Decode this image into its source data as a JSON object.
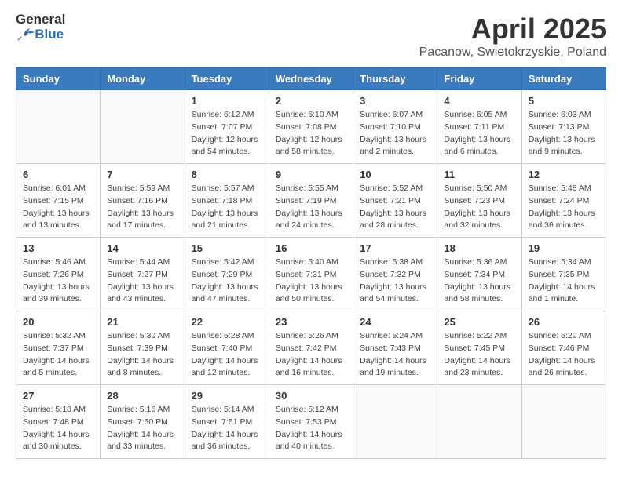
{
  "logo": {
    "general": "General",
    "blue": "Blue"
  },
  "title": {
    "month_year": "April 2025",
    "location": "Pacanow, Swietokrzyskie, Poland"
  },
  "headers": [
    "Sunday",
    "Monday",
    "Tuesday",
    "Wednesday",
    "Thursday",
    "Friday",
    "Saturday"
  ],
  "weeks": [
    [
      {
        "day": "",
        "info": ""
      },
      {
        "day": "",
        "info": ""
      },
      {
        "day": "1",
        "info": "Sunrise: 6:12 AM\nSunset: 7:07 PM\nDaylight: 12 hours\nand 54 minutes."
      },
      {
        "day": "2",
        "info": "Sunrise: 6:10 AM\nSunset: 7:08 PM\nDaylight: 12 hours\nand 58 minutes."
      },
      {
        "day": "3",
        "info": "Sunrise: 6:07 AM\nSunset: 7:10 PM\nDaylight: 13 hours\nand 2 minutes."
      },
      {
        "day": "4",
        "info": "Sunrise: 6:05 AM\nSunset: 7:11 PM\nDaylight: 13 hours\nand 6 minutes."
      },
      {
        "day": "5",
        "info": "Sunrise: 6:03 AM\nSunset: 7:13 PM\nDaylight: 13 hours\nand 9 minutes."
      }
    ],
    [
      {
        "day": "6",
        "info": "Sunrise: 6:01 AM\nSunset: 7:15 PM\nDaylight: 13 hours\nand 13 minutes."
      },
      {
        "day": "7",
        "info": "Sunrise: 5:59 AM\nSunset: 7:16 PM\nDaylight: 13 hours\nand 17 minutes."
      },
      {
        "day": "8",
        "info": "Sunrise: 5:57 AM\nSunset: 7:18 PM\nDaylight: 13 hours\nand 21 minutes."
      },
      {
        "day": "9",
        "info": "Sunrise: 5:55 AM\nSunset: 7:19 PM\nDaylight: 13 hours\nand 24 minutes."
      },
      {
        "day": "10",
        "info": "Sunrise: 5:52 AM\nSunset: 7:21 PM\nDaylight: 13 hours\nand 28 minutes."
      },
      {
        "day": "11",
        "info": "Sunrise: 5:50 AM\nSunset: 7:23 PM\nDaylight: 13 hours\nand 32 minutes."
      },
      {
        "day": "12",
        "info": "Sunrise: 5:48 AM\nSunset: 7:24 PM\nDaylight: 13 hours\nand 36 minutes."
      }
    ],
    [
      {
        "day": "13",
        "info": "Sunrise: 5:46 AM\nSunset: 7:26 PM\nDaylight: 13 hours\nand 39 minutes."
      },
      {
        "day": "14",
        "info": "Sunrise: 5:44 AM\nSunset: 7:27 PM\nDaylight: 13 hours\nand 43 minutes."
      },
      {
        "day": "15",
        "info": "Sunrise: 5:42 AM\nSunset: 7:29 PM\nDaylight: 13 hours\nand 47 minutes."
      },
      {
        "day": "16",
        "info": "Sunrise: 5:40 AM\nSunset: 7:31 PM\nDaylight: 13 hours\nand 50 minutes."
      },
      {
        "day": "17",
        "info": "Sunrise: 5:38 AM\nSunset: 7:32 PM\nDaylight: 13 hours\nand 54 minutes."
      },
      {
        "day": "18",
        "info": "Sunrise: 5:36 AM\nSunset: 7:34 PM\nDaylight: 13 hours\nand 58 minutes."
      },
      {
        "day": "19",
        "info": "Sunrise: 5:34 AM\nSunset: 7:35 PM\nDaylight: 14 hours\nand 1 minute."
      }
    ],
    [
      {
        "day": "20",
        "info": "Sunrise: 5:32 AM\nSunset: 7:37 PM\nDaylight: 14 hours\nand 5 minutes."
      },
      {
        "day": "21",
        "info": "Sunrise: 5:30 AM\nSunset: 7:39 PM\nDaylight: 14 hours\nand 8 minutes."
      },
      {
        "day": "22",
        "info": "Sunrise: 5:28 AM\nSunset: 7:40 PM\nDaylight: 14 hours\nand 12 minutes."
      },
      {
        "day": "23",
        "info": "Sunrise: 5:26 AM\nSunset: 7:42 PM\nDaylight: 14 hours\nand 16 minutes."
      },
      {
        "day": "24",
        "info": "Sunrise: 5:24 AM\nSunset: 7:43 PM\nDaylight: 14 hours\nand 19 minutes."
      },
      {
        "day": "25",
        "info": "Sunrise: 5:22 AM\nSunset: 7:45 PM\nDaylight: 14 hours\nand 23 minutes."
      },
      {
        "day": "26",
        "info": "Sunrise: 5:20 AM\nSunset: 7:46 PM\nDaylight: 14 hours\nand 26 minutes."
      }
    ],
    [
      {
        "day": "27",
        "info": "Sunrise: 5:18 AM\nSunset: 7:48 PM\nDaylight: 14 hours\nand 30 minutes."
      },
      {
        "day": "28",
        "info": "Sunrise: 5:16 AM\nSunset: 7:50 PM\nDaylight: 14 hours\nand 33 minutes."
      },
      {
        "day": "29",
        "info": "Sunrise: 5:14 AM\nSunset: 7:51 PM\nDaylight: 14 hours\nand 36 minutes."
      },
      {
        "day": "30",
        "info": "Sunrise: 5:12 AM\nSunset: 7:53 PM\nDaylight: 14 hours\nand 40 minutes."
      },
      {
        "day": "",
        "info": ""
      },
      {
        "day": "",
        "info": ""
      },
      {
        "day": "",
        "info": ""
      }
    ]
  ]
}
